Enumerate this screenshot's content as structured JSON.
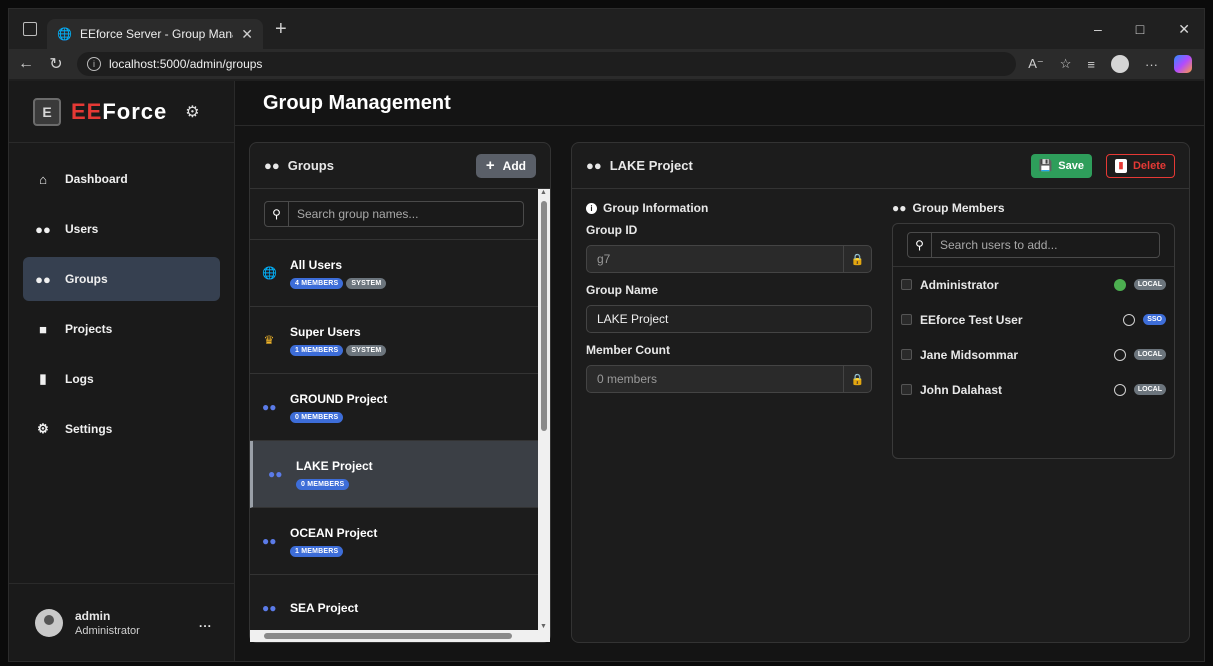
{
  "browser": {
    "tab_title": "EEforce Server - Group Managem",
    "url": "localhost:5000/admin/groups"
  },
  "brand": {
    "name_part1": "EE",
    "name_part2": "Force"
  },
  "sidebar": {
    "items": [
      {
        "label": "Dashboard",
        "icon": "home-icon"
      },
      {
        "label": "Users",
        "icon": "users-icon"
      },
      {
        "label": "Groups",
        "icon": "groups-icon"
      },
      {
        "label": "Projects",
        "icon": "folder-icon"
      },
      {
        "label": "Logs",
        "icon": "file-icon"
      },
      {
        "label": "Settings",
        "icon": "gear-icon"
      }
    ],
    "user": {
      "name": "admin",
      "role": "Administrator",
      "more": "..."
    }
  },
  "page": {
    "title": "Group Management"
  },
  "groups_panel": {
    "title": "Groups",
    "add_label": "Add",
    "search_placeholder": "Search group names...",
    "items": [
      {
        "name": "All Users",
        "members": "4 MEMBERS",
        "system": "SYSTEM",
        "icon": "globe-icon"
      },
      {
        "name": "Super Users",
        "members": "1 MEMBERS",
        "system": "SYSTEM",
        "icon": "crown-icon"
      },
      {
        "name": "GROUND Project",
        "members": "0 MEMBERS",
        "icon": "users-icon"
      },
      {
        "name": "LAKE Project",
        "members": "0 MEMBERS",
        "icon": "users-icon"
      },
      {
        "name": "OCEAN Project",
        "members": "1 MEMBERS",
        "icon": "users-icon"
      },
      {
        "name": "SEA Project",
        "icon": "users-icon"
      }
    ]
  },
  "detail": {
    "title": "LAKE Project",
    "save_label": "Save",
    "delete_label": "Delete",
    "info_title": "Group Information",
    "group_id_label": "Group ID",
    "group_id_value": "g7",
    "group_name_label": "Group Name",
    "group_name_value": "LAKE Project",
    "member_count_label": "Member Count",
    "member_count_value": "0 members",
    "members_title": "Group Members",
    "members_search_placeholder": "Search users to add...",
    "members": [
      {
        "name": "Administrator",
        "online": true,
        "source": "LOCAL"
      },
      {
        "name": "EEforce Test User",
        "online": false,
        "source": "SSO"
      },
      {
        "name": "Jane Midsommar",
        "online": false,
        "source": "LOCAL"
      },
      {
        "name": "John Dalahast",
        "online": false,
        "source": "LOCAL"
      }
    ]
  },
  "colors": {
    "brand_red": "#e53935",
    "member_badge": "#3d6dd8",
    "system_badge": "#6c757d",
    "save_green": "#2e9e5b",
    "online_green": "#4caf50"
  }
}
